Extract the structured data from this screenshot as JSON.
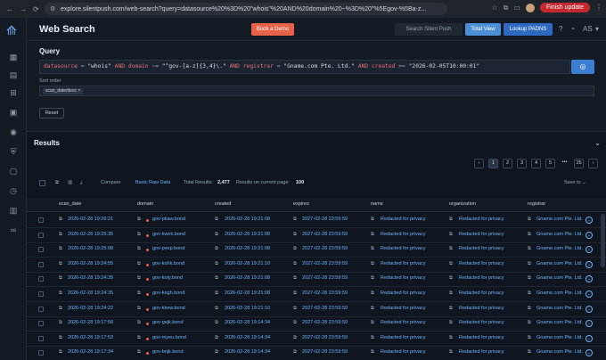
{
  "browser": {
    "url": "explore.silentpush.com/web-search?query=datasource%20%3D%20\"whois\"%20AND%20domain%20~%3D%20\"%5Egov-%5Ba-z...",
    "finish_update": "Finish update",
    "colors": {
      "finish_bg": "#c5282f"
    }
  },
  "app": {
    "title": "Web Search",
    "book_demo": "Book a Demo",
    "search_placeholder": "Search Silent Push",
    "total_view": "Total View",
    "lookup_padns": "Lookup PADNS",
    "user_initials": "AS",
    "colors": {
      "accent": "#3b7fd4",
      "demo": "#e8624a"
    }
  },
  "query": {
    "title": "Query",
    "sort_label": "Sort order",
    "sort_chip": "scan_date/desc",
    "reset": "Reset"
  },
  "results": {
    "title": "Results",
    "pages": [
      "1",
      "2",
      "3",
      "4",
      "5",
      "25"
    ],
    "ellipsis": "•••",
    "compare": "Compare",
    "basic_raw": "Basic Raw Data",
    "total_label": "Total Results:",
    "total_value": "2,477",
    "per_page_label": "Results on current page:",
    "per_page_value": "100",
    "save_to": "Save to",
    "columns": [
      "scan_date",
      "domain",
      "created",
      "expires",
      "name",
      "organization",
      "registrar"
    ],
    "rows": [
      {
        "scan_date": "2026-02-28 19:26:21",
        "domain": "gov-pkaw.bond",
        "created": "2026-02-28 19:21:08",
        "expires": "2027-02-28 23:59:59",
        "name": "Redacted for privacy",
        "organization": "Redacted for privacy",
        "registrar": "Gname.com Pte. Ltd."
      },
      {
        "scan_date": "2026-02-28 19:25:35",
        "domain": "gov-kwek.bond",
        "created": "2026-02-28 19:21:08",
        "expires": "2027-02-28 23:59:59",
        "name": "Redacted for privacy",
        "organization": "Redacted for privacy",
        "registrar": "Gname.com Pte. Ltd."
      },
      {
        "scan_date": "2026-02-28 19:25:08",
        "domain": "gov-pvep.bond",
        "created": "2026-02-28 19:21:08",
        "expires": "2027-02-28 23:59:59",
        "name": "Redacted for privacy",
        "organization": "Redacted for privacy",
        "registrar": "Gname.com Pte. Ltd."
      },
      {
        "scan_date": "2026-02-28 19:24:55",
        "domain": "gov-kohk.bond",
        "created": "2026-02-28 19:21:10",
        "expires": "2027-02-28 23:59:59",
        "name": "Redacted for privacy",
        "organization": "Redacted for privacy",
        "registrar": "Gname.com Pte. Ltd."
      },
      {
        "scan_date": "2026-02-28 19:24:35",
        "domain": "gov-koty.bond",
        "created": "2026-02-28 19:21:08",
        "expires": "2027-02-28 23:59:59",
        "name": "Redacted for privacy",
        "organization": "Redacted for privacy",
        "registrar": "Gname.com Pte. Ltd."
      },
      {
        "scan_date": "2026-02-28 19:24:35",
        "domain": "gov-kogh.bond",
        "created": "2026-02-28 19:21:08",
        "expires": "2027-02-28 23:59:59",
        "name": "Redacted for privacy",
        "organization": "Redacted for privacy",
        "registrar": "Gname.com Pte. Ltd."
      },
      {
        "scan_date": "2026-02-28 19:24:22",
        "domain": "gov-kkew.bond",
        "created": "2026-02-28 19:21:10",
        "expires": "2027-02-28 23:59:59",
        "name": "Redacted for privacy",
        "organization": "Redacted for privacy",
        "registrar": "Gname.com Pte. Ltd."
      },
      {
        "scan_date": "2026-02-28 19:17:58",
        "domain": "gov-gejk.bond",
        "created": "2026-02-28 19:14:34",
        "expires": "2027-02-28 23:59:59",
        "name": "Redacted for privacy",
        "organization": "Redacted for privacy",
        "registrar": "Gname.com Pte. Ltd."
      },
      {
        "scan_date": "2026-02-28 19:17:53",
        "domain": "gov-myeu.bond",
        "created": "2026-02-28 19:14:34",
        "expires": "2027-02-28 23:59:59",
        "name": "Redacted for privacy",
        "organization": "Redacted for privacy",
        "registrar": "Gname.com Pte. Ltd."
      },
      {
        "scan_date": "2026-02-28 19:17:34",
        "domain": "gov-bnjk.bond",
        "created": "2026-02-28 19:14:34",
        "expires": "2027-02-28 23:59:59",
        "name": "Redacted for privacy",
        "organization": "Redacted for privacy",
        "registrar": "Gname.com Pte. Ltd."
      }
    ]
  }
}
